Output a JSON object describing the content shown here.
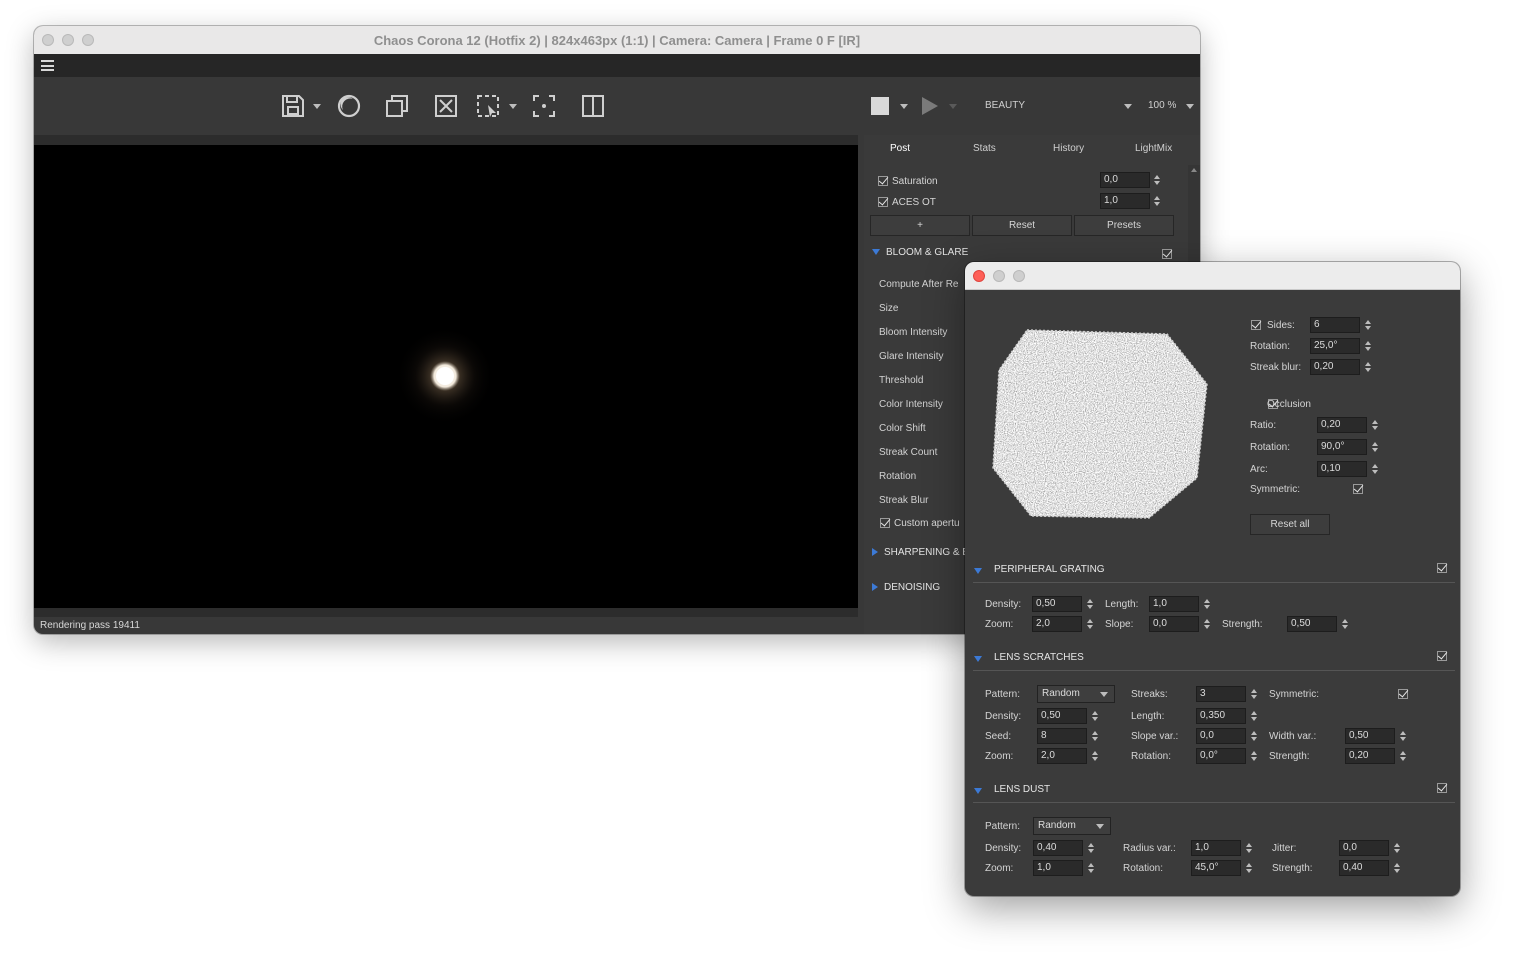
{
  "vfb": {
    "title": "Chaos Corona 12 (Hotfix 2) | 824x463px (1:1) | Camera: Camera | Frame 0 F [IR]",
    "render_element": "BEAUTY",
    "zoom": "100 %",
    "status": "Rendering pass 19411",
    "tabs": [
      "Post",
      "Stats",
      "History",
      "LightMix"
    ],
    "post": {
      "saturation_label": "Saturation",
      "saturation_value": "0,0",
      "aces_label": "ACES OT",
      "aces_value": "1,0",
      "add_label": "+",
      "reset_label": "Reset",
      "presets_label": "Presets"
    },
    "bloom": {
      "header": "BLOOM & GLARE",
      "items": [
        "Compute After Re",
        "Size",
        "Bloom Intensity",
        "Glare Intensity",
        "Threshold",
        "Color Intensity",
        "Color Shift",
        "Streak Count",
        "Rotation",
        "Streak Blur"
      ],
      "custom_aperture": "Custom apertu"
    },
    "sharpening_header": "SHARPENING & B",
    "denoising_header": "DENOISING"
  },
  "aperture": {
    "sides_label": "Sides:",
    "sides": "6",
    "rotation_label": "Rotation:",
    "rotation": "25,0°",
    "streak_blur_label": "Streak blur:",
    "streak_blur": "0,20",
    "occlusion_label": "Occlusion",
    "ratio_label": "Ratio:",
    "ratio": "0,20",
    "occ_rotation_label": "Rotation:",
    "occ_rotation": "90,0°",
    "arc_label": "Arc:",
    "arc": "0,10",
    "symmetric_label": "Symmetric:",
    "reset_all": "Reset all"
  },
  "peripheral": {
    "header": "PERIPHERAL GRATING",
    "density_label": "Density:",
    "density": "0,50",
    "length_label": "Length:",
    "length": "1,0",
    "zoom_label": "Zoom:",
    "zoom": "2,0",
    "slope_label": "Slope:",
    "slope": "0,0",
    "strength_label": "Strength:",
    "strength": "0,50"
  },
  "scratches": {
    "header": "LENS SCRATCHES",
    "pattern_label": "Pattern:",
    "pattern": "Random",
    "streaks_label": "Streaks:",
    "streaks": "3",
    "symmetric_label": "Symmetric:",
    "density_label": "Density:",
    "density": "0,50",
    "length_label": "Length:",
    "length": "0,350",
    "seed_label": "Seed:",
    "seed": "8",
    "slope_var_label": "Slope var.:",
    "slope_var": "0,0",
    "width_var_label": "Width var.:",
    "width_var": "0,50",
    "zoom_label": "Zoom:",
    "zoom": "2,0",
    "rotation_label": "Rotation:",
    "rotation": "0,0°",
    "strength_label": "Strength:",
    "strength": "0,20"
  },
  "dust": {
    "header": "LENS DUST",
    "pattern_label": "Pattern:",
    "pattern": "Random",
    "density_label": "Density:",
    "density": "0,40",
    "radius_var_label": "Radius var.:",
    "radius_var": "1,0",
    "jitter_label": "Jitter:",
    "jitter": "0,0",
    "zoom_label": "Zoom:",
    "zoom": "1,0",
    "rotation_label": "Rotation:",
    "rotation": "45,0°",
    "strength_label": "Strength:",
    "strength": "0,40"
  },
  "colors": {
    "accent": "#3c7ad6",
    "close_red": "#fe5f57"
  }
}
